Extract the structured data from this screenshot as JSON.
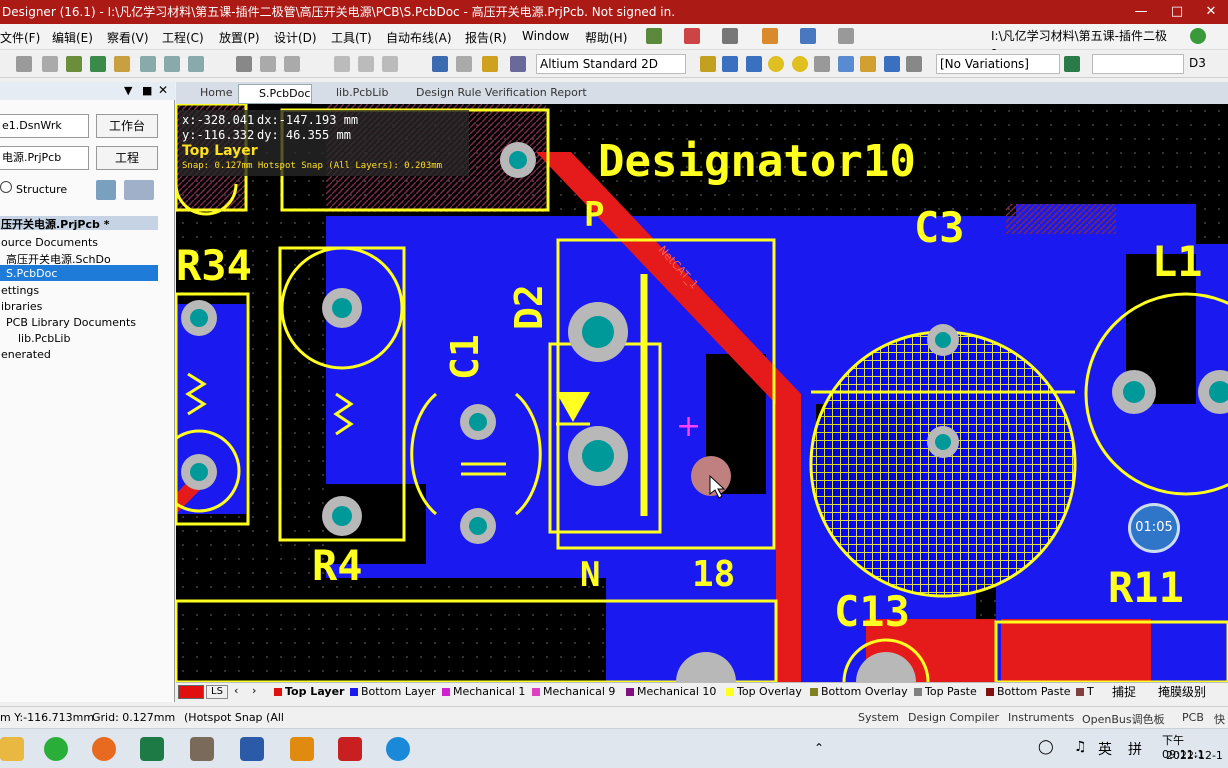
{
  "window": {
    "title": "Designer (16.1) - I:\\凡亿学习材料\\第五课-插件二极管\\高压开关电源\\PCB\\S.PcbDoc - 高压开关电源.PrjPcb. Not signed in."
  },
  "menu": [
    "文件(F)",
    "编辑(E)",
    "察看(V)",
    "工程(C)",
    "放置(P)",
    "设计(D)",
    "工具(T)",
    "自动布线(A)",
    "报告(R)",
    "Window",
    "帮助(H)"
  ],
  "menu_path": "I:\\凡亿学习材料\\第五课-插件二极1",
  "toolbar": {
    "view_mode": "Altium Standard 2D",
    "variations": "[No Variations]",
    "designator": "D3"
  },
  "panel": {
    "workspace": "e1.DsnWrk",
    "workspace_btn": "工作台",
    "project": "电源.PrjPcb",
    "project_btn": "工程",
    "structure": "Structure",
    "tree": [
      "压开关电源.PrjPcb *",
      "ource Documents",
      "高压开关电源.SchDo",
      "S.PcbDoc",
      "ettings",
      "ibraries",
      "PCB Library Documents",
      "lib.PcbLib",
      "enerated"
    ]
  },
  "tabs": [
    "Home",
    "S.PcbDoc",
    "lib.PcbLib",
    "Design Rule Verification Report"
  ],
  "hud": {
    "x": "x:-328.041",
    "dx": "dx:-147.193 mm",
    "y": "y:-116.332",
    "dy": "dy: 46.355   mm",
    "layer": "Top Layer",
    "snap": "Snap: 0.127mm Hotspot Snap (All Layers): 0.203mm"
  },
  "pcb": {
    "labels": [
      "Designator10",
      "C3",
      "L1",
      "R34",
      "D2",
      "C1",
      "P",
      "N",
      "18",
      "R4",
      "C13",
      "R11"
    ],
    "net": "NetCAT_1",
    "center": "+"
  },
  "layers": [
    {
      "name": "Top Layer",
      "color": "#e01010"
    },
    {
      "name": "Bottom Layer",
      "color": "#1a1aee"
    },
    {
      "name": "Mechanical 1",
      "color": "#d020d0"
    },
    {
      "name": "Mechanical 9",
      "color": "#e040c0"
    },
    {
      "name": "Mechanical 10",
      "color": "#801080"
    },
    {
      "name": "Top Overlay",
      "color": "#ffff20"
    },
    {
      "name": "Bottom Overlay",
      "color": "#808020"
    },
    {
      "name": "Top Paste",
      "color": "#808080"
    },
    {
      "name": "Bottom Paste",
      "color": "#801010"
    }
  ],
  "layerbar": {
    "ls": "LS",
    "extra": "T",
    "snap": "捕捉",
    "mask": "掩膜级别"
  },
  "status": {
    "coords": "m Y:-116.713mm",
    "grid": "Grid: 0.127mm",
    "snap": "(Hotspot Snap (All",
    "panels": [
      "System",
      "Design Compiler",
      "Instruments",
      "OpenBus调色板",
      "PCB",
      "快"
    ]
  },
  "timer": "01:05",
  "taskbar": {
    "time": "下午 09:11:1",
    "date": "2022-12-1",
    "lang": "英",
    "ime": "拼"
  }
}
